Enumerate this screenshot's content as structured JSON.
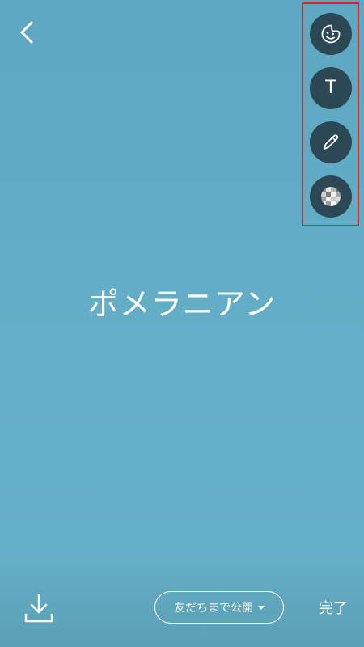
{
  "header": {
    "back_icon": "chevron-left-icon"
  },
  "tools": [
    {
      "name": "sticker",
      "icon": "sticker-face-icon"
    },
    {
      "name": "text",
      "icon": "text-icon",
      "glyph": "T"
    },
    {
      "name": "draw",
      "icon": "pencil-icon"
    },
    {
      "name": "mosaic",
      "icon": "mosaic-icon"
    }
  ],
  "content": {
    "text": "ポメラニアン"
  },
  "footer": {
    "download_icon": "download-icon",
    "privacy_label": "友だちまで公開",
    "done_label": "完了"
  },
  "colors": {
    "background": "#63adc6",
    "tool_button": "#2c4855",
    "highlight_border": "#e0202a",
    "foreground": "#ffffff"
  }
}
